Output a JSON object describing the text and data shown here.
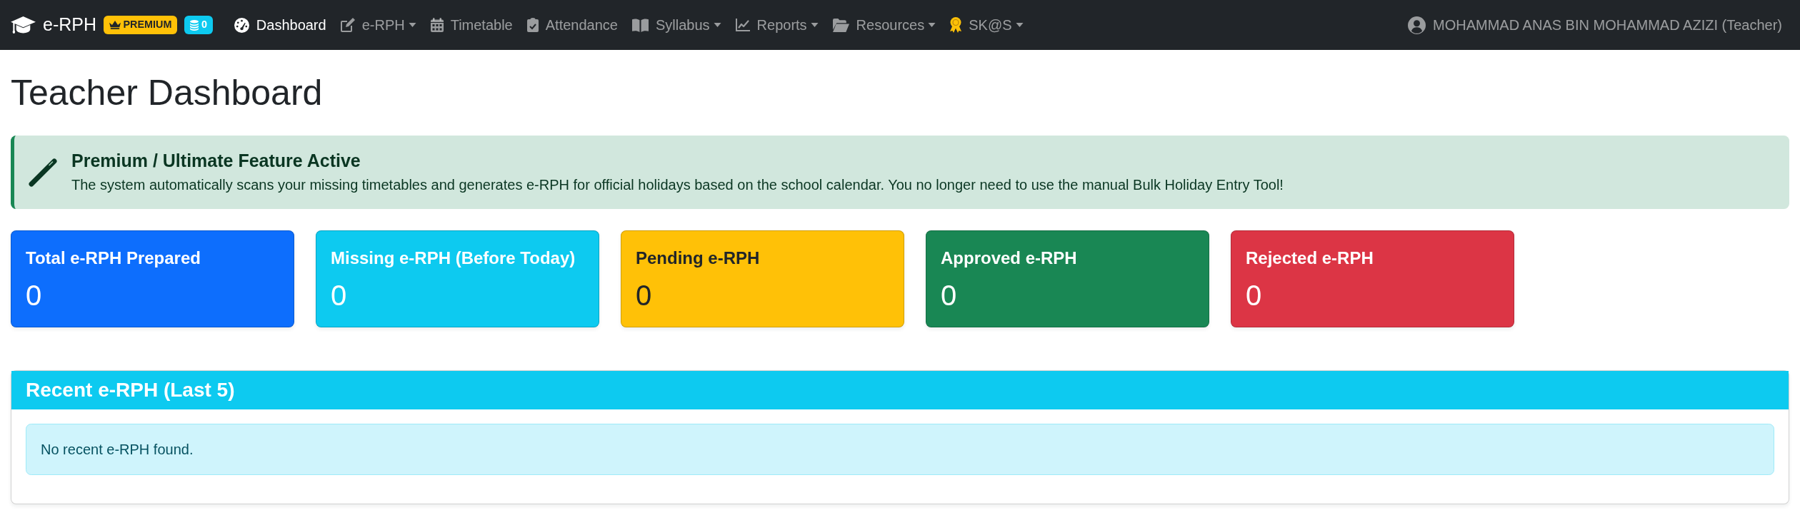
{
  "navbar": {
    "brand": "e-RPH",
    "badges": [
      {
        "kind": "premium",
        "text": "PREMIUM"
      },
      {
        "kind": "coins",
        "text": "0"
      }
    ],
    "items": [
      {
        "label": "Dashboard",
        "selected": true,
        "dropdown": false
      },
      {
        "label": "e-RPH",
        "selected": false,
        "dropdown": true
      },
      {
        "label": "Timetable",
        "selected": false,
        "dropdown": false
      },
      {
        "label": "Attendance",
        "selected": false,
        "dropdown": false
      },
      {
        "label": "Syllabus",
        "selected": false,
        "dropdown": true
      },
      {
        "label": "Reports",
        "selected": false,
        "dropdown": true
      },
      {
        "label": "Resources",
        "selected": false,
        "dropdown": true
      },
      {
        "label": "SK@S",
        "selected": false,
        "dropdown": true
      }
    ],
    "user": "MOHAMMAD ANAS BIN MOHAMMAD AZIZI (Teacher)"
  },
  "page_title": "Teacher Dashboard",
  "feature_alert": {
    "title": "Premium / Ultimate Feature Active",
    "text": "The system automatically scans your missing timetables and generates e-RPH for official holidays based on the school calendar. You no longer need to use the manual Bulk Holiday Entry Tool!"
  },
  "stats": [
    {
      "title": "Total e-RPH Prepared",
      "value": "0",
      "color": "#0d6efd"
    },
    {
      "title": "Missing e-RPH (Before Today)",
      "value": "0",
      "color": "#0dcaf0"
    },
    {
      "title": "Pending e-RPH",
      "value": "0",
      "color": "#ffc107"
    },
    {
      "title": "Approved e-RPH",
      "value": "0",
      "color": "#198754"
    },
    {
      "title": "Rejected e-RPH",
      "value": "0",
      "color": "#dc3545"
    }
  ],
  "recent": {
    "title": "Recent e-RPH (Last 5)",
    "empty_message": "No recent e-RPH found."
  }
}
